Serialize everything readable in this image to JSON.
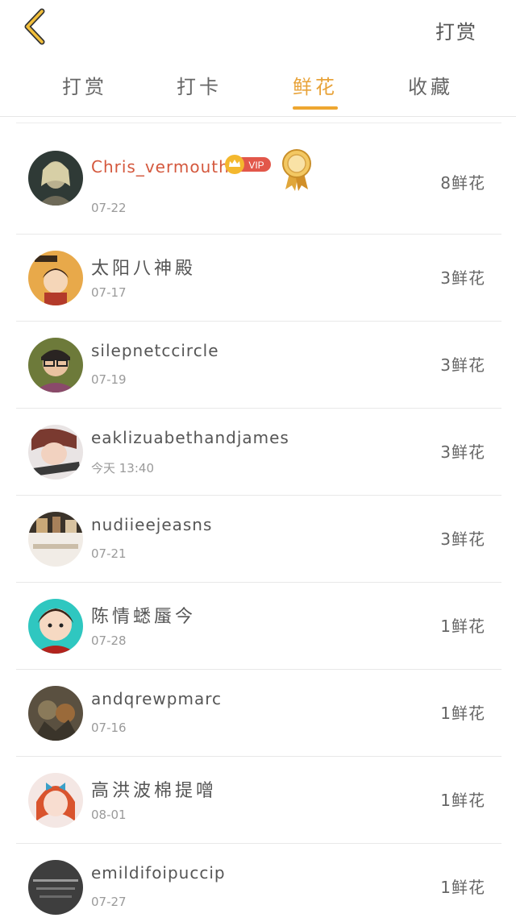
{
  "header": {
    "back_icon": "chevron-left-icon",
    "action_label": "打赏",
    "accent_color": "#eea630"
  },
  "tabs": [
    {
      "label": "打赏",
      "active": false
    },
    {
      "label": "打卡",
      "active": false
    },
    {
      "label": "鲜花",
      "active": true
    },
    {
      "label": "收藏",
      "active": false
    }
  ],
  "list": [
    {
      "name": "Chris_vermouth",
      "date": "07-22",
      "count": "8鲜花",
      "vip": "VIP"
    },
    {
      "name": "太阳八神殿",
      "date": "07-17",
      "count": "3鲜花"
    },
    {
      "name": "silepnetccircle",
      "date": "07-19",
      "count": "3鲜花"
    },
    {
      "name": "eaklizuabethandjames",
      "date": "今天 13:40",
      "count": "3鲜花"
    },
    {
      "name": "nudiieejeasns",
      "date": "07-21",
      "count": "3鲜花"
    },
    {
      "name": "陈情蟋蜃今",
      "date": "07-28",
      "count": "1鲜花"
    },
    {
      "name": "andqrewpmarc",
      "date": "07-16",
      "count": "1鲜花"
    },
    {
      "name": "高洪波棉提噌",
      "date": "08-01",
      "count": "1鲜花"
    },
    {
      "name": "emildifoipuccip",
      "date": "07-27",
      "count": "1鲜花"
    }
  ]
}
